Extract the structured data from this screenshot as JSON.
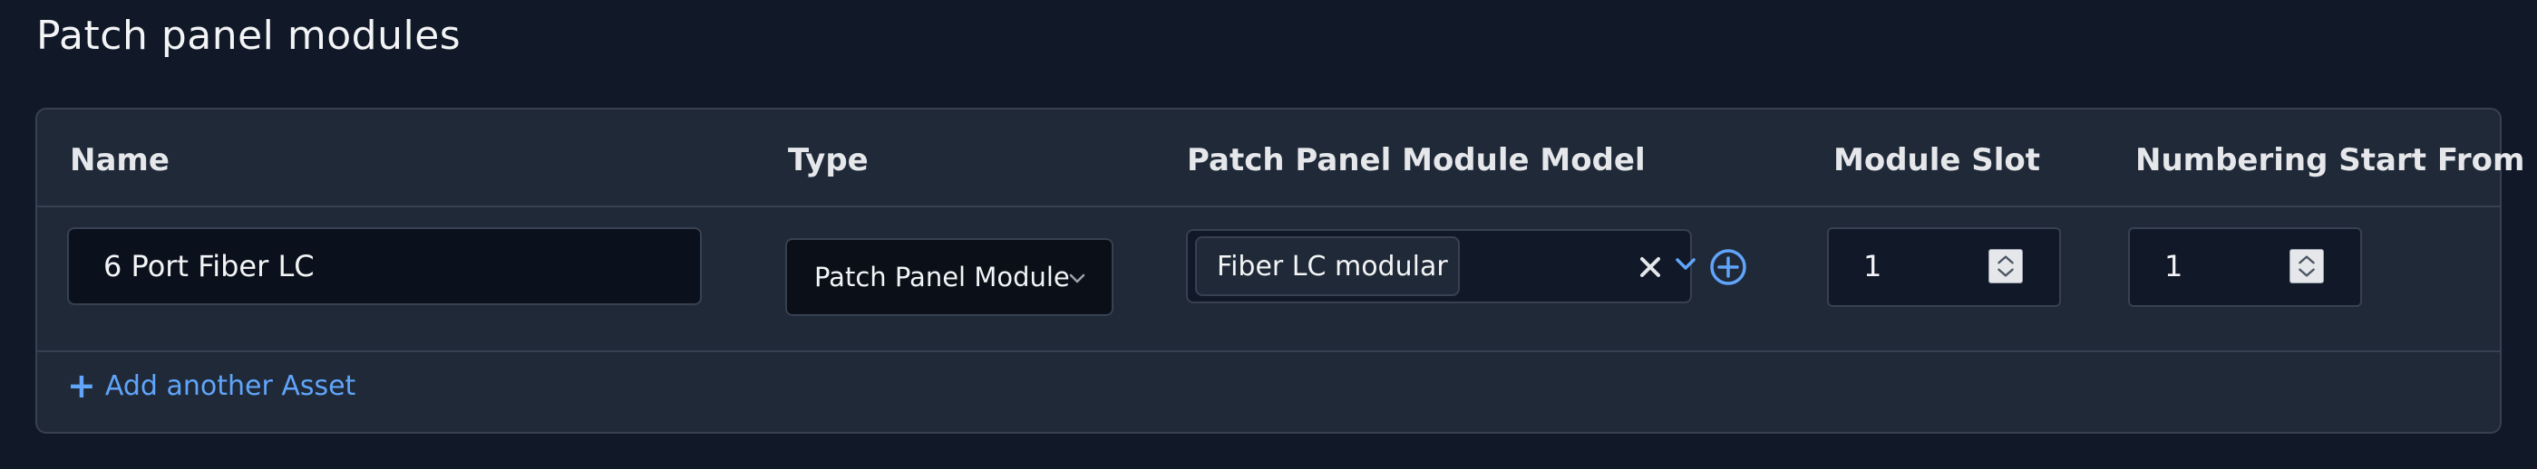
{
  "section": {
    "title": "Patch panel modules"
  },
  "table": {
    "columns": [
      "Name",
      "Type",
      "Patch Panel Module Model",
      "Module Slot",
      "Numbering Start From"
    ],
    "rows": [
      {
        "name": "6 Port Fiber LC",
        "type": "Patch Panel Module",
        "model": "Fiber LC modular",
        "module_slot": "1",
        "numbering_start_from": "1"
      }
    ]
  },
  "actions": {
    "add_another_label": "Add another Asset",
    "add_another_icon": "plus-icon"
  },
  "icons": {
    "type_dropdown": "chevron-down-icon",
    "clear_model": "close-icon",
    "model_dropdown": "chevron-down-icon",
    "add_model": "plus-circle-icon",
    "number_spinner": "spinner-arrows-icon"
  },
  "colors": {
    "background": "#111827",
    "card": "#1f2937",
    "border": "#374151",
    "accent": "#60a5fa"
  }
}
